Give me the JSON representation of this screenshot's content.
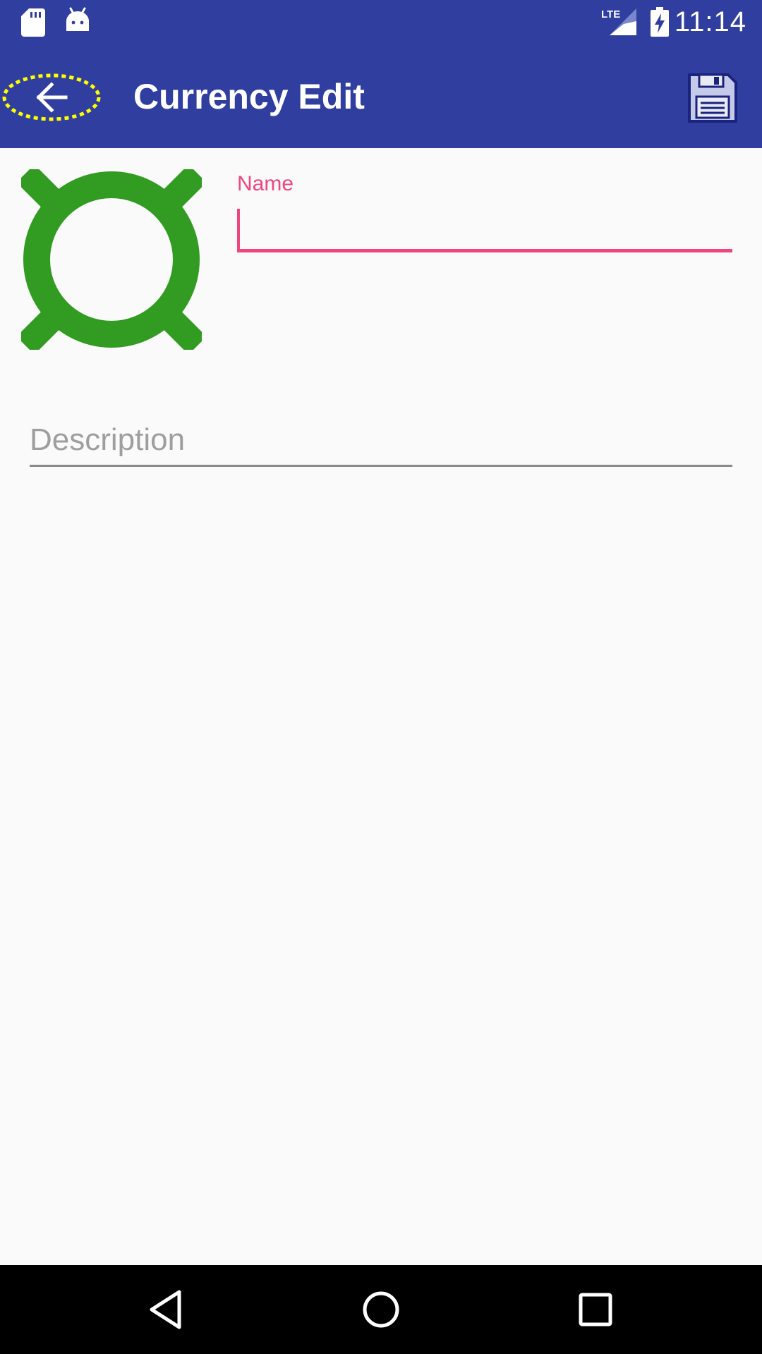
{
  "status_bar": {
    "time": "11:14",
    "network": "LTE",
    "icons": [
      "sd-card-icon",
      "android-icon",
      "lte-signal-icon",
      "battery-charging-icon"
    ]
  },
  "app_bar": {
    "title": "Currency Edit",
    "back_icon": "arrow-left-icon",
    "save_icon": "floppy-disk-icon"
  },
  "form": {
    "currency_icon": "currency-sign-icon",
    "name": {
      "label": "Name",
      "value": ""
    },
    "description": {
      "placeholder": "Description",
      "value": ""
    }
  },
  "nav_bar": {
    "icons": [
      "back-triangle-icon",
      "home-circle-icon",
      "recents-square-icon"
    ]
  },
  "colors": {
    "primary": "#303f9f",
    "accent": "#f0457f",
    "currency_icon": "#319b22",
    "background": "#fafafa"
  }
}
